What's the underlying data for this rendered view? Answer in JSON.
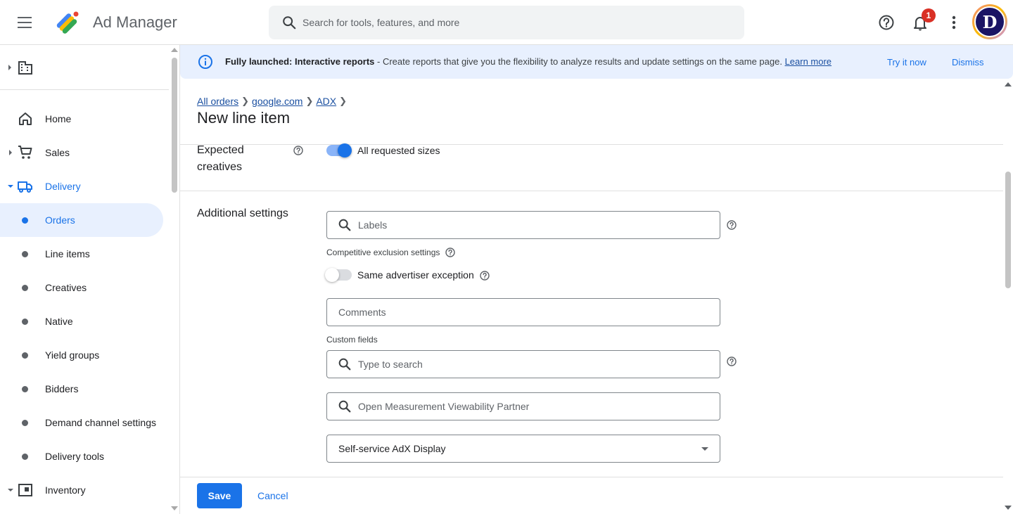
{
  "header": {
    "app_name": "Ad Manager",
    "search_placeholder": "Search for tools, features, and more",
    "notification_count": "1",
    "avatar_letter": "D"
  },
  "sidebar": {
    "items": [
      {
        "label": "Home",
        "icon": "home-icon"
      },
      {
        "label": "Sales",
        "icon": "cart-icon"
      },
      {
        "label": "Delivery",
        "icon": "truck-icon"
      },
      {
        "label": "Orders"
      },
      {
        "label": "Line items"
      },
      {
        "label": "Creatives"
      },
      {
        "label": "Native"
      },
      {
        "label": "Yield groups"
      },
      {
        "label": "Bidders"
      },
      {
        "label": "Demand channel settings"
      },
      {
        "label": "Delivery tools"
      },
      {
        "label": "Inventory",
        "icon": "inventory-icon"
      }
    ]
  },
  "banner": {
    "bold": "Fully launched: Interactive reports",
    "text": " - Create reports that give you the flexibility to analyze results and update settings on the same page. ",
    "learn_more": "Learn more",
    "try_it": "Try it now",
    "dismiss": "Dismiss"
  },
  "breadcrumb": {
    "items": [
      "All orders",
      "google.com",
      "ADX"
    ]
  },
  "page": {
    "title": "New line item"
  },
  "expected_creatives": {
    "label_line1": "Expected",
    "label_line2": "creatives",
    "toggle_label": "All requested sizes",
    "toggle_on": true
  },
  "additional_settings": {
    "label": "Additional settings",
    "labels_placeholder": "Labels",
    "competitive_exclusion_label": "Competitive exclusion settings",
    "same_advertiser_label": "Same advertiser exception",
    "same_advertiser_on": false,
    "comments_placeholder": "Comments",
    "custom_fields_label": "Custom fields",
    "custom_fields_placeholder": "Type to search",
    "om_partner_placeholder": "Open Measurement Viewability Partner",
    "line_item_type_value": "Self-service AdX Display"
  },
  "footer": {
    "save": "Save",
    "cancel": "Cancel"
  },
  "colors": {
    "primary": "#1a73e8",
    "banner_bg": "#e8f0fe",
    "badge": "#d93025"
  }
}
